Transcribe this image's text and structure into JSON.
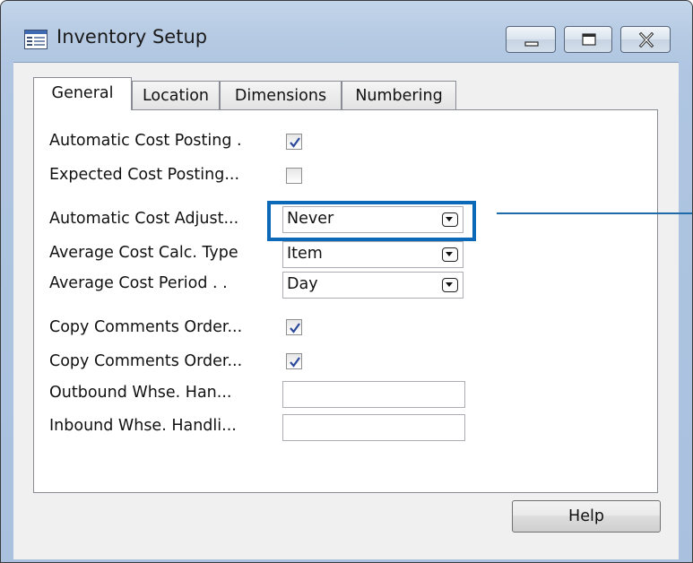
{
  "window": {
    "title": "Inventory Setup"
  },
  "tabs": [
    {
      "label": "General",
      "active": true
    },
    {
      "label": "Location",
      "active": false
    },
    {
      "label": "Dimensions",
      "active": false
    },
    {
      "label": "Numbering",
      "active": false
    }
  ],
  "fields": {
    "automatic_cost_posting": {
      "label": "Automatic Cost Posting  .",
      "checked": true
    },
    "expected_cost_posting": {
      "label": "Expected Cost Posting...",
      "checked": false
    },
    "automatic_cost_adjustment": {
      "label": "Automatic Cost Adjust...",
      "value": "Never"
    },
    "average_cost_calc_type": {
      "label": "Average Cost Calc. Type",
      "value": "Item"
    },
    "average_cost_period": {
      "label": "Average Cost Period  .  .",
      "value": "Day"
    },
    "copy_comments_order_1": {
      "label": "Copy Comments Order...",
      "checked": true
    },
    "copy_comments_order_2": {
      "label": "Copy Comments Order...",
      "checked": true
    },
    "outbound_whse_handling": {
      "label": "Outbound Whse. Han...",
      "value": ""
    },
    "inbound_whse_handling": {
      "label": "Inbound Whse. Handli...",
      "value": ""
    }
  },
  "buttons": {
    "help_label": "Help"
  },
  "icons": {
    "app": "form-icon",
    "minimize": "minimize-icon",
    "maximize": "maximize-icon",
    "close": "close-icon",
    "check": "checkmark-icon",
    "dropdown": "dropdown-arrow-icon"
  },
  "colors": {
    "highlight": "#0c69b7",
    "checkmark": "#2c4a9c",
    "frame": "#afc5e1"
  }
}
